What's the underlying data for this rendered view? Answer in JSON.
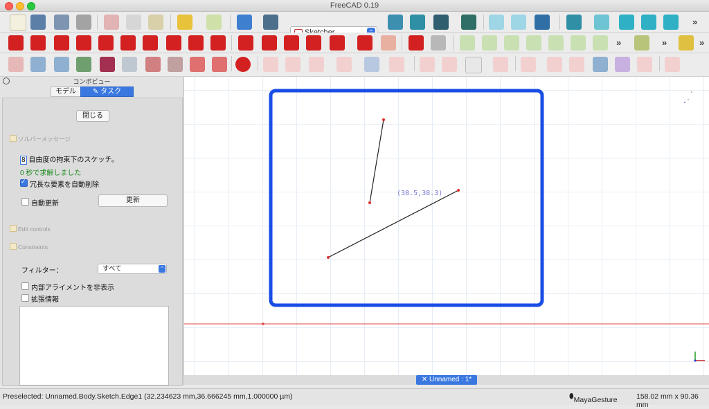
{
  "window": {
    "title": "FreeCAD 0.19"
  },
  "toolbar": {
    "workbench": "Sketcher",
    "overflow_label": "»"
  },
  "combo": {
    "title": "コンボビュー",
    "tabs": {
      "model": "モデル",
      "task": "タスク"
    },
    "close_button": "閉じる",
    "solver_section": "ソルバーメッセージ",
    "dof_number": "8",
    "dof_text": "自由度の拘束下のスケッチ。",
    "solved_text": "0 秒で求解しました",
    "auto_remove_redundant": "冗長な要素を自動削除",
    "auto_update": "自動更新",
    "update_button": "更新",
    "edit_controls": "Edit controls",
    "constraints": "Constraints",
    "filter_label": "フィルター：",
    "filter_value": "すべて",
    "hide_internal": "内部アライメントを非表示",
    "extended_info": "拡張情報"
  },
  "view": {
    "cursor_coords": "(38.5,38.3)",
    "doc_tab": "✕ Unnamed : 1*",
    "highlight_color": "#1a4de6"
  },
  "status": {
    "preselected": "Preselected: Unnamed.Body.Sketch.Edge1 (32.234623 mm,36.666245 mm,1.000000 µm)",
    "navigation": "MayaGesture",
    "dimensions": "158.02 mm x 90.36 mm"
  }
}
